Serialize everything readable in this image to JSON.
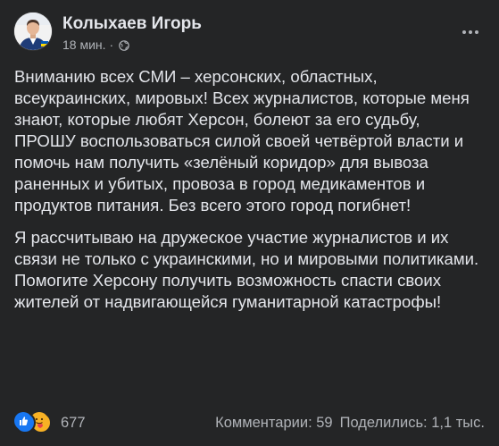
{
  "post": {
    "author": "Колыхаев Игорь",
    "time": "18 мин.",
    "separator": "·",
    "paragraphs": [
      "Вниманию всех СМИ – херсонских, областных, всеукраинских, мировых! Всех журналистов, которые меня знают, которые любят Херсон, болеют за его судьбу, ПРОШУ воспользоваться силой своей четвёртой власти и помочь нам получить «зелёный коридор» для вывоза раненных и убитых, провоза в город медикаментов и продуктов питания. Без всего этого город погибнет!",
      "Я рассчитываю на дружеское участие журналистов и их связи не только с украинскими, но и мировыми политиками. Помогите Херсону получить возможность спасти своих жителей от надвигающейся гуманитарной катастрофы!"
    ]
  },
  "footer": {
    "reaction_count": "677",
    "comments": "Комментарии: 59",
    "shares": "Поделились: 1,1 тыс."
  },
  "icons": {
    "avatar": "avatar-photo",
    "privacy": "globe-icon",
    "more": "more-options-icon",
    "reactions": [
      "like-reaction-icon",
      "care-reaction-icon"
    ]
  },
  "colors": {
    "background": "#242526",
    "primary_text": "#e4e6eb",
    "secondary_text": "#b0b3b8",
    "like_blue": "#1877f2",
    "care_yellow": "#f7b125"
  }
}
